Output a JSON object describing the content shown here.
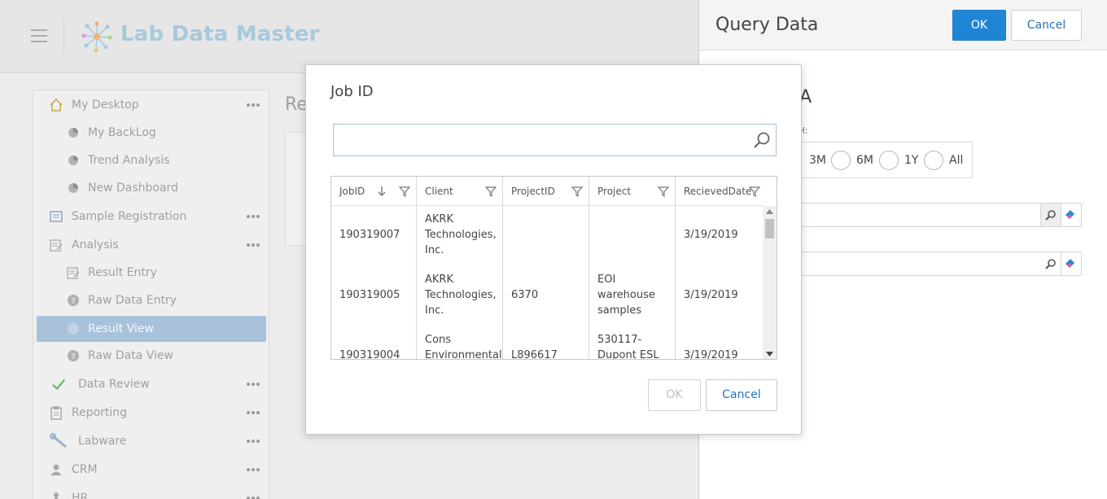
{
  "app": {
    "brand": "Lab Data Master"
  },
  "sidebar": {
    "items": [
      {
        "label": "My Desktop",
        "icon": "home-icon",
        "more": true
      },
      {
        "label": "My BackLog",
        "icon": "dashboard-pie-icon",
        "more": false
      },
      {
        "label": "Trend Analysis",
        "icon": "dashboard-pie-icon",
        "more": false
      },
      {
        "label": "New Dashboard",
        "icon": "dashboard-pie-icon",
        "more": false
      },
      {
        "label": "Sample Registration",
        "icon": "registration-icon",
        "more": true
      },
      {
        "label": "Analysis",
        "icon": "analysis-icon",
        "more": true
      },
      {
        "label": "Result Entry",
        "icon": "edit-document-icon",
        "more": false
      },
      {
        "label": "Raw Data Entry",
        "icon": "help-circle-icon",
        "more": false
      },
      {
        "label": "Result View",
        "icon": "circle-icon",
        "more": false,
        "active": true
      },
      {
        "label": "Raw Data View",
        "icon": "help-circle-icon",
        "more": false
      },
      {
        "label": "Data Review",
        "icon": "check-icon",
        "more": true
      },
      {
        "label": "Reporting",
        "icon": "clipboard-icon",
        "more": true
      },
      {
        "label": "Labware",
        "icon": "wrench-icon",
        "more": true
      },
      {
        "label": "CRM",
        "icon": "user-icon",
        "more": true
      },
      {
        "label": "HR",
        "icon": "person-icon",
        "more": true
      }
    ]
  },
  "background": {
    "title": "Re"
  },
  "panel": {
    "title": "Query Data",
    "ok_label": "OK",
    "cancel_label": "Cancel",
    "section_title": "ATA",
    "month_label": "ONTH:",
    "radios": [
      "3M",
      "6M",
      "1Y",
      "All"
    ]
  },
  "modal": {
    "title": "Job ID",
    "search_placeholder": "",
    "ok_label": "OK",
    "cancel_label": "Cancel",
    "columns": [
      "JobID",
      "Client",
      "ProjectID",
      "Project",
      "RecievedDate"
    ],
    "rows": [
      {
        "jobid": "190319007",
        "client": "AKRK Technologies, Inc.",
        "projectid": "",
        "project": "",
        "date": "3/19/2019"
      },
      {
        "jobid": "190319005",
        "client": "AKRK Technologies, Inc.",
        "projectid": "6370",
        "project": "EOI warehouse samples",
        "date": "3/19/2019"
      },
      {
        "jobid": "190319004",
        "client": "Cons Environmental",
        "projectid": "L896617",
        "project": "530117-Dupont ESL",
        "date": "3/19/2019"
      }
    ]
  },
  "colors": {
    "accent": "#1f86d6",
    "active_nav": "#a8c2dc"
  }
}
